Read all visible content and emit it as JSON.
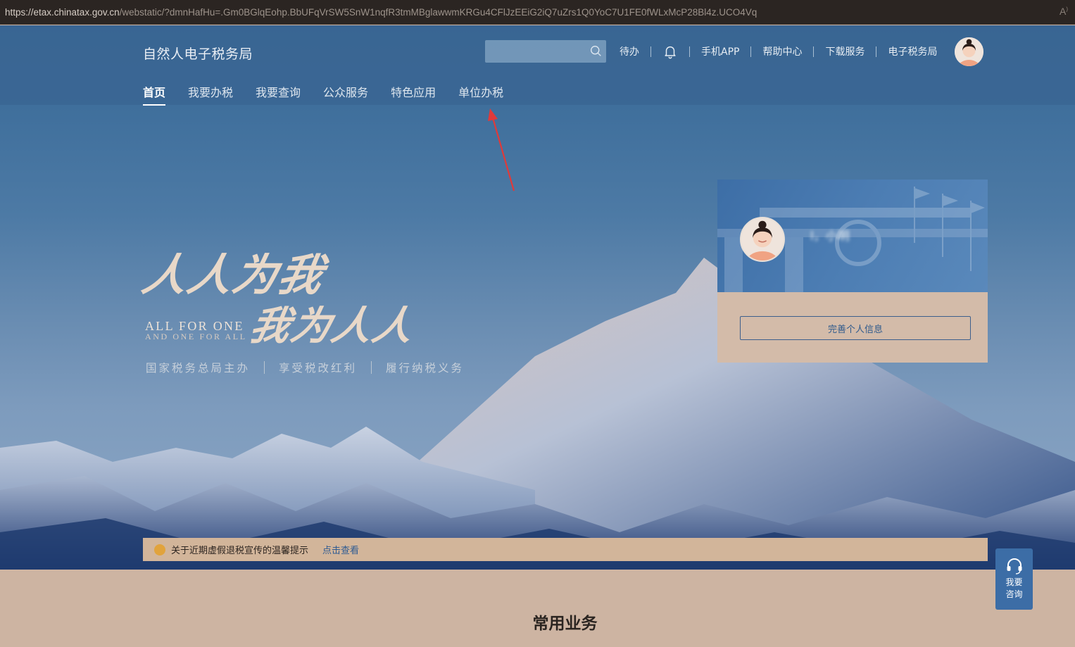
{
  "browser": {
    "url_host": "https://etax.chinatax.gov.cn",
    "url_path": "/webstatic/?dmnHafHu=.Gm0BGlqEohp.BbUFqVrSW5SnW1nqfR3tmMBglawwmKRGu4CFlJzEEiG2iQ7uZrs1Q0YoC7U1FE0fWLxMcP28Bl4z.UCO4Vq",
    "reader_icon": "A⁰"
  },
  "header": {
    "site_title": "自然人电子税务局",
    "search": {
      "placeholder": "",
      "value": ""
    },
    "links": {
      "todo": "待办",
      "mobile_app": "手机APP",
      "help": "帮助中心",
      "download": "下载服务",
      "etax_bureau": "电子税务局"
    }
  },
  "nav": {
    "items": [
      "首页",
      "我要办税",
      "我要查询",
      "公众服务",
      "特色应用",
      "单位办税"
    ],
    "active_index": 0
  },
  "slogan": {
    "cn_line1": "人人为我",
    "cn_line2": "我为人人",
    "en_line1": "ALL FOR ONE",
    "en_line2": "AND ONE FOR ALL",
    "taglines": [
      "国家税务总局主办",
      "享受税改红利",
      "履行纳税义务"
    ]
  },
  "user_card": {
    "name": "l，小明",
    "complete_profile_label": "完善个人信息"
  },
  "notice": {
    "text": "关于近期虚假退税宣传的温馨提示",
    "link": "点击查看"
  },
  "consult": {
    "label": "我要咨询"
  },
  "section": {
    "title": "常用业务"
  },
  "colors": {
    "header_bg": "#3a6491",
    "card_beige": "#d3bba9",
    "accent_blue": "#3c6da6",
    "annotation_red": "#e03a3a"
  }
}
